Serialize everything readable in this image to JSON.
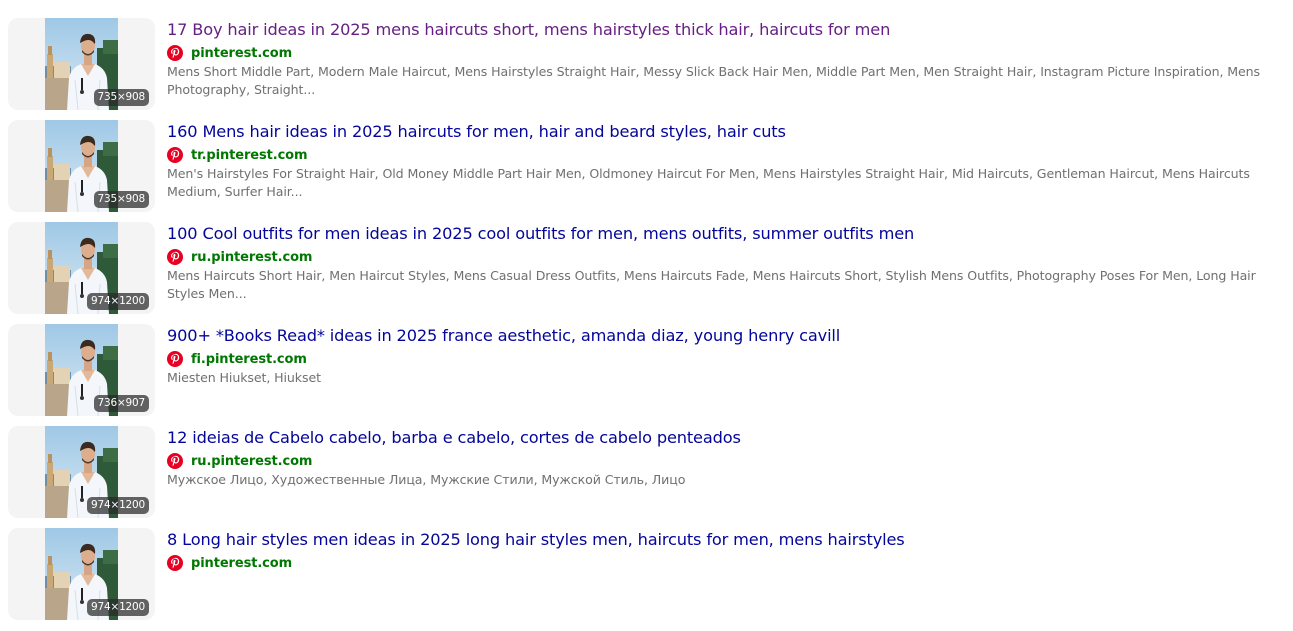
{
  "results": [
    {
      "title": "17 Boy hair ideas in 2025 mens haircuts short, mens hairstyles thick hair, haircuts for men",
      "visited": true,
      "domain": "pinterest.com",
      "description": "Mens Short Middle Part, Modern Male Haircut, Mens Hairstyles Straight Hair, Messy Slick Back Hair Men, Middle Part Men, Men Straight Hair, Instagram Picture Inspiration, Mens Photography, Straight...",
      "dimensions": "735×908"
    },
    {
      "title": "160 Mens hair ideas in 2025 haircuts for men, hair and beard styles, hair cuts",
      "visited": false,
      "domain": "tr.pinterest.com",
      "description": "Men's Hairstyles For Straight Hair, Old Money Middle Part Hair Men, Oldmoney Haircut For Men, Mens Hairstyles Straight Hair, Mid Haircuts, Gentleman Haircut, Mens Haircuts Medium, Surfer Hair...",
      "dimensions": "735×908"
    },
    {
      "title": "100 Cool outfits for men ideas in 2025 cool outfits for men, mens outfits, summer outfits men",
      "visited": false,
      "domain": "ru.pinterest.com",
      "description": "Mens Haircuts Short Hair, Men Haircut Styles, Mens Casual Dress Outfits, Mens Haircuts Fade, Mens Haircuts Short, Stylish Mens Outfits, Photography Poses For Men, Long Hair Styles Men...",
      "dimensions": "974×1200"
    },
    {
      "title": "900+ *Books Read* ideas in 2025 france aesthetic, amanda diaz, young henry cavill",
      "visited": false,
      "domain": "fi.pinterest.com",
      "description": "Miesten Hiukset, Hiukset",
      "dimensions": "736×907"
    },
    {
      "title": "12 ideias de Cabelo cabelo, barba e cabelo, cortes de cabelo penteados",
      "visited": false,
      "domain": "ru.pinterest.com",
      "description": "Мужское Лицо, Художественные Лица, Мужские Стили, Мужской Стиль, Лицо",
      "dimensions": "974×1200"
    },
    {
      "title": "8 Long hair styles men ideas in 2025 long hair styles men, haircuts for men, mens hairstyles",
      "visited": false,
      "domain": "pinterest.com",
      "description": "",
      "dimensions": "974×1200"
    }
  ],
  "icons": {
    "source": "pinterest-icon",
    "thumbnail": "photo-man-white-shirt-seaside"
  },
  "colors": {
    "link": "#04059a",
    "visited_link": "#661f84",
    "domain": "#007700",
    "description": "#707070",
    "pinterest_red": "#e60023",
    "thumb_bg": "#f4f4f5"
  }
}
